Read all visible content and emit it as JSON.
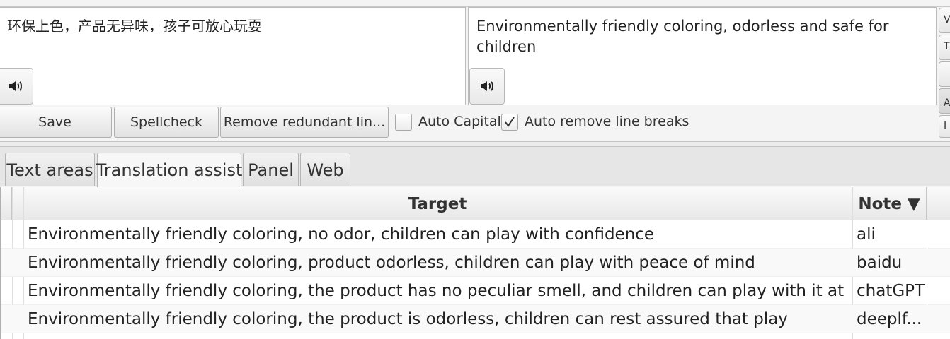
{
  "source_text": "环保上色，产品无异味，孩子可放心玩耍",
  "target_text": "Environmentally friendly coloring, odorless and safe for children",
  "speaker_icon": "speaker-icon",
  "edge_buttons": [
    "V",
    "T",
    "",
    "A",
    "I"
  ],
  "toolbar": {
    "save_label": "Save",
    "spellcheck_label": "Spellcheck",
    "remove_label": "Remove redundant lin...",
    "auto_capital_label": "Auto Capital",
    "auto_capital_checked": false,
    "auto_remove_label": "Auto remove line breaks",
    "auto_remove_checked": true
  },
  "tabs": [
    {
      "label": "Text areas",
      "active": false
    },
    {
      "label": "Translation assist",
      "active": true
    },
    {
      "label": "Panel",
      "active": false
    },
    {
      "label": "Web",
      "active": false
    }
  ],
  "table": {
    "columns": {
      "target": "Target",
      "note": "Note ▼"
    },
    "rows": [
      {
        "target": "Environmentally friendly coloring, no odor, children can play with confidence",
        "note": "ali"
      },
      {
        "target": "Environmentally friendly coloring, product odorless, children can play with peace of mind",
        "note": "baidu"
      },
      {
        "target": "Environmentally friendly coloring, the product has no peculiar smell, and children can play with it at ease.",
        "note": "chatGPT"
      },
      {
        "target": "Environmentally friendly coloring, the product is odorless, children can rest assured that play",
        "note": "deeplf..."
      }
    ]
  }
}
